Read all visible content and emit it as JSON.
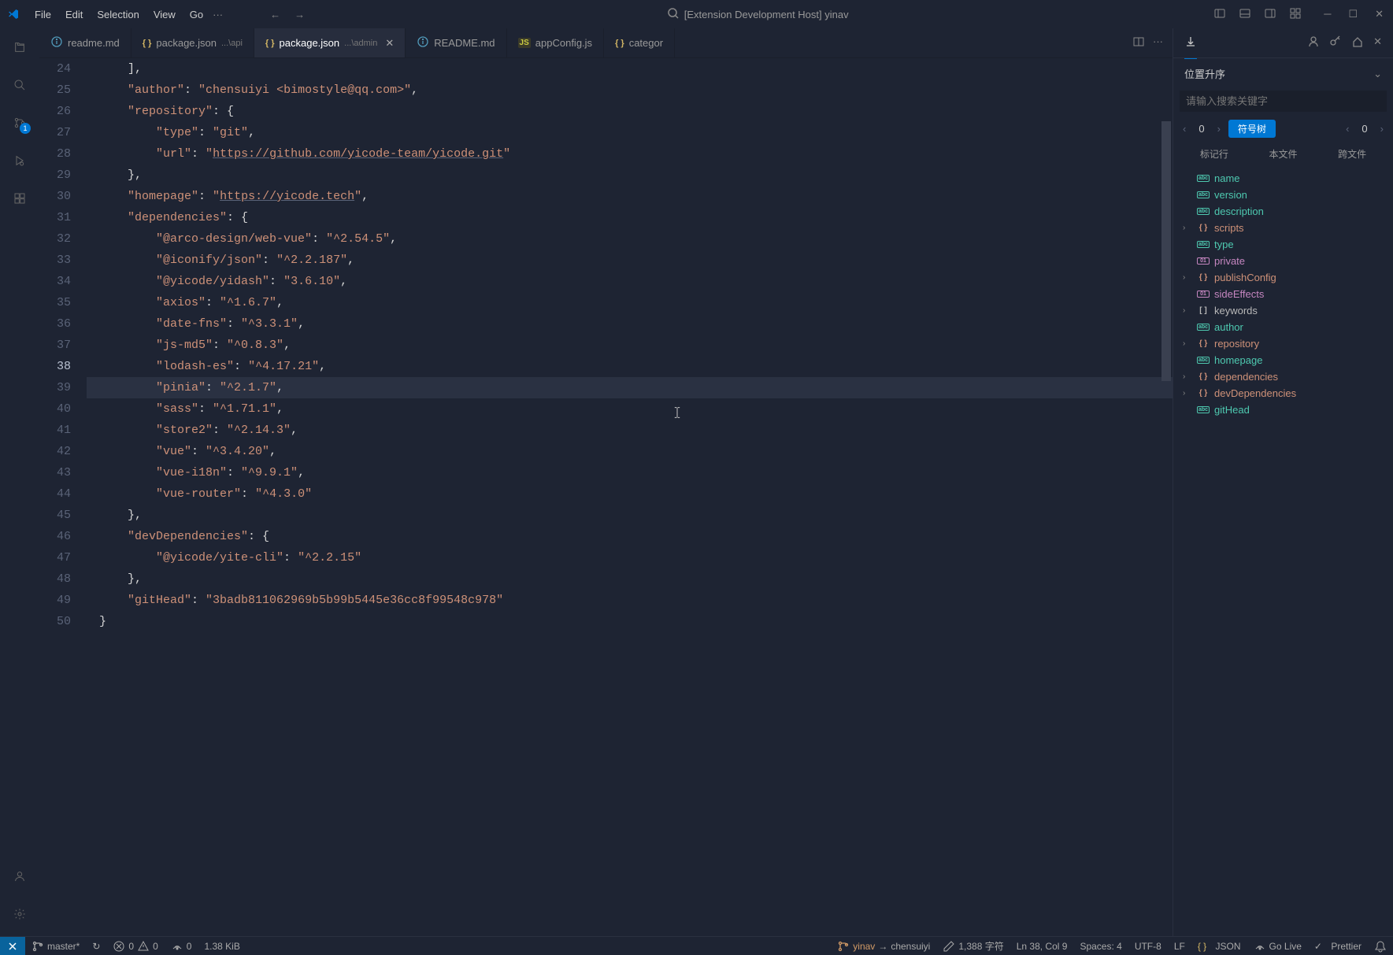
{
  "titlebar": {
    "menus": [
      "File",
      "Edit",
      "Selection",
      "View",
      "Go"
    ],
    "more": "···",
    "centerTitle": "[Extension Development Host] yinav"
  },
  "activitybar": {
    "scmBadge": "1"
  },
  "tabs": [
    {
      "icon": "md",
      "name": "readme.md",
      "active": false
    },
    {
      "icon": "json",
      "name": "package.json",
      "path": "...\\api",
      "active": false
    },
    {
      "icon": "json",
      "name": "package.json",
      "path": "...\\admin",
      "active": true,
      "close": true
    },
    {
      "icon": "md",
      "name": "README.md",
      "active": false
    },
    {
      "icon": "js",
      "name": "appConfig.js",
      "active": false
    },
    {
      "icon": "json",
      "name": "categor",
      "active": false
    }
  ],
  "tabActionsMore": "···",
  "lineNumbers": [
    24,
    25,
    26,
    27,
    28,
    29,
    30,
    31,
    32,
    33,
    34,
    35,
    36,
    37,
    38,
    39,
    40,
    41,
    42,
    43,
    44,
    45,
    46,
    47,
    48,
    49
  ],
  "activeLine": 38,
  "code": [
    {
      "indent": 1,
      "parts": [
        {
          "t": "],",
          "c": "punct"
        }
      ]
    },
    {
      "indent": 1,
      "parts": [
        {
          "t": "\"author\"",
          "c": "key"
        },
        {
          "t": ": ",
          "c": "punct"
        },
        {
          "t": "\"chensuiyi <bimostyle@qq.com>\"",
          "c": "str"
        },
        {
          "t": ",",
          "c": "punct"
        }
      ]
    },
    {
      "indent": 1,
      "parts": [
        {
          "t": "\"repository\"",
          "c": "key"
        },
        {
          "t": ": {",
          "c": "punct"
        }
      ]
    },
    {
      "indent": 2,
      "parts": [
        {
          "t": "\"type\"",
          "c": "key"
        },
        {
          "t": ": ",
          "c": "punct"
        },
        {
          "t": "\"git\"",
          "c": "str"
        },
        {
          "t": ",",
          "c": "punct"
        }
      ]
    },
    {
      "indent": 2,
      "parts": [
        {
          "t": "\"url\"",
          "c": "key"
        },
        {
          "t": ": ",
          "c": "punct"
        },
        {
          "t": "\"",
          "c": "str"
        },
        {
          "t": "https://github.com/yicode-team/yicode.git",
          "c": "url"
        },
        {
          "t": "\"",
          "c": "str"
        }
      ]
    },
    {
      "indent": 1,
      "parts": [
        {
          "t": "},",
          "c": "punct"
        }
      ]
    },
    {
      "indent": 1,
      "parts": [
        {
          "t": "\"homepage\"",
          "c": "key"
        },
        {
          "t": ": ",
          "c": "punct"
        },
        {
          "t": "\"",
          "c": "str"
        },
        {
          "t": "https://yicode.tech",
          "c": "url"
        },
        {
          "t": "\"",
          "c": "str"
        },
        {
          "t": ",",
          "c": "punct"
        }
      ]
    },
    {
      "indent": 1,
      "parts": [
        {
          "t": "\"dependencies\"",
          "c": "key"
        },
        {
          "t": ": {",
          "c": "punct"
        }
      ]
    },
    {
      "indent": 2,
      "parts": [
        {
          "t": "\"@arco-design/web-vue\"",
          "c": "key"
        },
        {
          "t": ": ",
          "c": "punct"
        },
        {
          "t": "\"^2.54.5\"",
          "c": "str"
        },
        {
          "t": ",",
          "c": "punct"
        }
      ]
    },
    {
      "indent": 2,
      "parts": [
        {
          "t": "\"@iconify/json\"",
          "c": "key"
        },
        {
          "t": ": ",
          "c": "punct"
        },
        {
          "t": "\"^2.2.187\"",
          "c": "str"
        },
        {
          "t": ",",
          "c": "punct"
        }
      ]
    },
    {
      "indent": 2,
      "parts": [
        {
          "t": "\"@yicode/yidash\"",
          "c": "key"
        },
        {
          "t": ": ",
          "c": "punct"
        },
        {
          "t": "\"3.6.10\"",
          "c": "str"
        },
        {
          "t": ",",
          "c": "punct"
        }
      ]
    },
    {
      "indent": 2,
      "parts": [
        {
          "t": "\"axios\"",
          "c": "key"
        },
        {
          "t": ": ",
          "c": "punct"
        },
        {
          "t": "\"^1.6.7\"",
          "c": "str"
        },
        {
          "t": ",",
          "c": "punct"
        }
      ]
    },
    {
      "indent": 2,
      "parts": [
        {
          "t": "\"date-fns\"",
          "c": "key"
        },
        {
          "t": ": ",
          "c": "punct"
        },
        {
          "t": "\"^3.3.1\"",
          "c": "str"
        },
        {
          "t": ",",
          "c": "punct"
        }
      ]
    },
    {
      "indent": 2,
      "parts": [
        {
          "t": "\"js-md5\"",
          "c": "key"
        },
        {
          "t": ": ",
          "c": "punct"
        },
        {
          "t": "\"^0.8.3\"",
          "c": "str"
        },
        {
          "t": ",",
          "c": "punct"
        }
      ]
    },
    {
      "indent": 2,
      "parts": [
        {
          "t": "\"lodash-es\"",
          "c": "key"
        },
        {
          "t": ": ",
          "c": "punct"
        },
        {
          "t": "\"^4.17.21\"",
          "c": "str"
        },
        {
          "t": ",",
          "c": "punct"
        }
      ]
    },
    {
      "indent": 2,
      "hl": true,
      "parts": [
        {
          "t": "\"pinia\"",
          "c": "key"
        },
        {
          "t": ": ",
          "c": "punct"
        },
        {
          "t": "\"^2.1.7\"",
          "c": "str"
        },
        {
          "t": ",",
          "c": "punct"
        }
      ]
    },
    {
      "indent": 2,
      "parts": [
        {
          "t": "\"sass\"",
          "c": "key"
        },
        {
          "t": ": ",
          "c": "punct"
        },
        {
          "t": "\"^1.71.1\"",
          "c": "str"
        },
        {
          "t": ",",
          "c": "punct"
        }
      ]
    },
    {
      "indent": 2,
      "parts": [
        {
          "t": "\"store2\"",
          "c": "key"
        },
        {
          "t": ": ",
          "c": "punct"
        },
        {
          "t": "\"^2.14.3\"",
          "c": "str"
        },
        {
          "t": ",",
          "c": "punct"
        }
      ]
    },
    {
      "indent": 2,
      "parts": [
        {
          "t": "\"vue\"",
          "c": "key"
        },
        {
          "t": ": ",
          "c": "punct"
        },
        {
          "t": "\"^3.4.20\"",
          "c": "str"
        },
        {
          "t": ",",
          "c": "punct"
        }
      ]
    },
    {
      "indent": 2,
      "parts": [
        {
          "t": "\"vue-i18n\"",
          "c": "key"
        },
        {
          "t": ": ",
          "c": "punct"
        },
        {
          "t": "\"^9.9.1\"",
          "c": "str"
        },
        {
          "t": ",",
          "c": "punct"
        }
      ]
    },
    {
      "indent": 2,
      "parts": [
        {
          "t": "\"vue-router\"",
          "c": "key"
        },
        {
          "t": ": ",
          "c": "punct"
        },
        {
          "t": "\"^4.3.0\"",
          "c": "str"
        }
      ]
    },
    {
      "indent": 1,
      "parts": [
        {
          "t": "},",
          "c": "punct"
        }
      ]
    },
    {
      "indent": 1,
      "parts": [
        {
          "t": "\"devDependencies\"",
          "c": "key"
        },
        {
          "t": ": {",
          "c": "punct"
        }
      ]
    },
    {
      "indent": 2,
      "parts": [
        {
          "t": "\"@yicode/yite-cli\"",
          "c": "key"
        },
        {
          "t": ": ",
          "c": "punct"
        },
        {
          "t": "\"^2.2.15\"",
          "c": "str"
        }
      ]
    },
    {
      "indent": 1,
      "parts": [
        {
          "t": "},",
          "c": "punct"
        }
      ]
    },
    {
      "indent": 1,
      "parts": [
        {
          "t": "\"gitHead\"",
          "c": "key"
        },
        {
          "t": ": ",
          "c": "punct"
        },
        {
          "t": "\"3badb811062969b5b99b5445e36cc8f99548c978\"",
          "c": "str"
        }
      ]
    },
    {
      "indent": 0,
      "parts": [
        {
          "t": "}",
          "c": "punct"
        }
      ]
    },
    {
      "indent": 0,
      "parts": []
    }
  ],
  "sidepanel": {
    "sortLabel": "位置升序",
    "searchPlaceholder": "请输入搜索关键字",
    "count1": "0",
    "symbolTreeBtn": "符号树",
    "count2": "0",
    "filters": [
      "标记行",
      "本文件",
      "跨文件"
    ],
    "tree": [
      {
        "type": "abc",
        "label": "name"
      },
      {
        "type": "abc",
        "label": "version"
      },
      {
        "type": "abc",
        "label": "description"
      },
      {
        "type": "obj",
        "label": "scripts",
        "expandable": true
      },
      {
        "type": "abc",
        "label": "type"
      },
      {
        "type": "bool",
        "label": "private"
      },
      {
        "type": "obj",
        "label": "publishConfig",
        "expandable": true
      },
      {
        "type": "bool",
        "label": "sideEffects"
      },
      {
        "type": "arr",
        "label": "keywords",
        "expandable": true
      },
      {
        "type": "abc",
        "label": "author"
      },
      {
        "type": "obj",
        "label": "repository",
        "expandable": true
      },
      {
        "type": "abc",
        "label": "homepage"
      },
      {
        "type": "obj",
        "label": "dependencies",
        "expandable": true
      },
      {
        "type": "obj",
        "label": "devDependencies",
        "expandable": true
      },
      {
        "type": "abc",
        "label": "gitHead"
      }
    ]
  },
  "statusbar": {
    "branch": "master*",
    "sync": "↻",
    "errors": "0",
    "warnings": "0",
    "radio": "0",
    "size": "1.38 KiB",
    "yinav": "yinav",
    "arrow": "→",
    "chensuiyi": "chensuiyi",
    "chars": "1,388 字符",
    "position": "Ln 38, Col 9",
    "spaces": "Spaces: 4",
    "encoding": "UTF-8",
    "eol": "LF",
    "lang": "JSON",
    "golive": "Go Live",
    "prettier": "Prettier"
  }
}
